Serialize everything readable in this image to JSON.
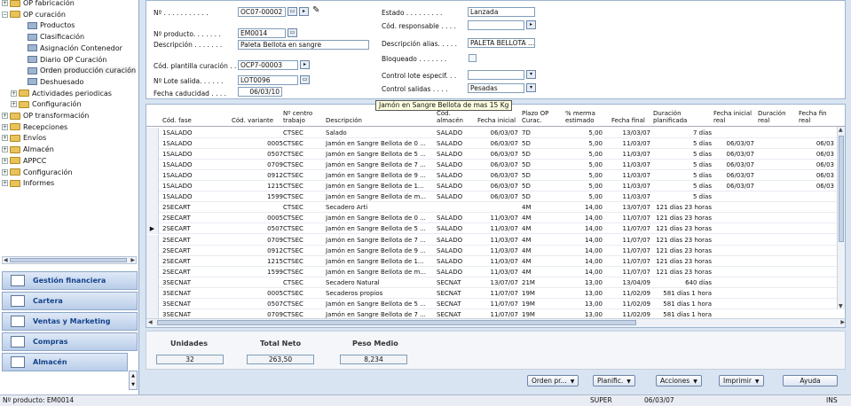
{
  "nav": {
    "tree": [
      {
        "label": "OP fabricación",
        "level": 0,
        "type": "folder",
        "expander": "+"
      },
      {
        "label": "OP curación",
        "level": 0,
        "type": "folder",
        "expander": "−"
      },
      {
        "label": "Productos",
        "level": 2,
        "type": "doc"
      },
      {
        "label": "Clasificación",
        "level": 2,
        "type": "doc"
      },
      {
        "label": "Asignación Contenedor",
        "level": 2,
        "type": "doc"
      },
      {
        "label": "Diario OP Curación",
        "level": 2,
        "type": "doc"
      },
      {
        "label": "Orden producción curación",
        "level": 2,
        "type": "doc"
      },
      {
        "label": "Deshuesado",
        "level": 2,
        "type": "doc"
      },
      {
        "label": "Actividades periodicas",
        "level": 1,
        "type": "folder",
        "expander": "+"
      },
      {
        "label": "Configuración",
        "level": 1,
        "type": "folder",
        "expander": "+"
      },
      {
        "label": "OP transformación",
        "level": 0,
        "type": "folder",
        "expander": "+"
      },
      {
        "label": "Recepciones",
        "level": 0,
        "type": "folder",
        "expander": "+"
      },
      {
        "label": "Envíos",
        "level": 0,
        "type": "folder",
        "expander": "+"
      },
      {
        "label": "Almacén",
        "level": 0,
        "type": "folder",
        "expander": "+"
      },
      {
        "label": "APPCC",
        "level": 0,
        "type": "folder",
        "expander": "+"
      },
      {
        "label": "Configuración",
        "level": 0,
        "type": "folder",
        "expander": "+"
      },
      {
        "label": "Informes",
        "level": 0,
        "type": "folder",
        "expander": "+"
      }
    ],
    "modules": [
      "Gestión financiera",
      "Cartera",
      "Ventas y Marketing",
      "Compras",
      "Almacén"
    ]
  },
  "form": {
    "no_label": "Nº . . . . . . . . . . .",
    "no_value": "OC07-00002",
    "producto_label": "Nº producto. . . . . . .",
    "producto_value": "EM0014",
    "descripcion_label": "Descripción . . . . . . .",
    "descripcion_value": "Paleta Bellota en sangre",
    "plantilla_label": "Cód. plantilla curación . .",
    "plantilla_value": "OCP7-00003",
    "lote_label": "Nº Lote salida. . . . . .",
    "lote_value": "LOT0096",
    "caducidad_label": "Fecha caducidad . . . .",
    "caducidad_value": "06/03/10",
    "estado_label": "Estado . . . . . . . . .",
    "estado_value": "Lanzada",
    "responsable_label": "Cód. responsable . . . .",
    "responsable_value": "",
    "desc_alias_label": "Descripción alias. . . . .",
    "desc_alias_value": "PALETA BELLOTA ...",
    "bloqueado_label": "Bloqueado . . . . . . .",
    "control_lote_label": "Control lote especif. . .",
    "control_lote_value": "",
    "control_salidas_label": "Control salidas . . . .",
    "control_salidas_value": "Pesadas"
  },
  "grid": {
    "headers": {
      "fase": "Cód. fase",
      "variante": "Cód. variante",
      "centro": "Nº centro\ntrabajo",
      "descripcion": "Descripción",
      "almacen": "Cód.\nalmacén",
      "fecha_inicial": "Fecha inicial",
      "plazo": "Plazo OP\nCurac.",
      "merma": "% merma\nestimado",
      "fecha_final": "Fecha final",
      "duracion_plan": "Duración\nplanificada",
      "fecha_inicial_real": "Fecha inicial\nreal",
      "duracion_real": "Duración\nreal",
      "fecha_fin_real": "Fecha fin\nreal"
    },
    "rows": [
      {
        "fase": "1SALADO",
        "variante": "",
        "centro": "CTSEC",
        "descripcion": "Salado",
        "almacen": "SALADO",
        "fecha_inicial": "06/03/07",
        "plazo": "7D",
        "merma": "5,00",
        "fecha_final": "13/03/07",
        "duracion_plan": "7 días",
        "fecha_inicial_real": "",
        "duracion_real": "",
        "fecha_fin_real": "",
        "current": false
      },
      {
        "fase": "1SALADO",
        "variante": "0005",
        "centro": "CTSEC",
        "descripcion": "Jamón en Sangre Bellota de 0 ...",
        "almacen": "SALADO",
        "fecha_inicial": "06/03/07",
        "plazo": "5D",
        "merma": "5,00",
        "fecha_final": "11/03/07",
        "duracion_plan": "5 días",
        "fecha_inicial_real": "06/03/07",
        "duracion_real": "",
        "fecha_fin_real": "06/03",
        "current": false
      },
      {
        "fase": "1SALADO",
        "variante": "0507",
        "centro": "CTSEC",
        "descripcion": "Jamón en Sangre Bellota de 5 ...",
        "almacen": "SALADO",
        "fecha_inicial": "06/03/07",
        "plazo": "5D",
        "merma": "5,00",
        "fecha_final": "11/03/07",
        "duracion_plan": "5 días",
        "fecha_inicial_real": "06/03/07",
        "duracion_real": "",
        "fecha_fin_real": "06/03",
        "current": false
      },
      {
        "fase": "1SALADO",
        "variante": "0709",
        "centro": "CTSEC",
        "descripcion": "Jamón en Sangre Bellota de 7 ...",
        "almacen": "SALADO",
        "fecha_inicial": "06/03/07",
        "plazo": "5D",
        "merma": "5,00",
        "fecha_final": "11/03/07",
        "duracion_plan": "5 días",
        "fecha_inicial_real": "06/03/07",
        "duracion_real": "",
        "fecha_fin_real": "06/03",
        "current": false
      },
      {
        "fase": "1SALADO",
        "variante": "0912",
        "centro": "CTSEC",
        "descripcion": "Jamón en Sangre Bellota de 9 ...",
        "almacen": "SALADO",
        "fecha_inicial": "06/03/07",
        "plazo": "5D",
        "merma": "5,00",
        "fecha_final": "11/03/07",
        "duracion_plan": "5 días",
        "fecha_inicial_real": "06/03/07",
        "duracion_real": "",
        "fecha_fin_real": "06/03",
        "current": false
      },
      {
        "fase": "1SALADO",
        "variante": "1215",
        "centro": "CTSEC",
        "descripcion": "Jamón en Sangre Bellota de 1...",
        "almacen": "SALADO",
        "fecha_inicial": "06/03/07",
        "plazo": "5D",
        "merma": "5,00",
        "fecha_final": "11/03/07",
        "duracion_plan": "5 días",
        "fecha_inicial_real": "06/03/07",
        "duracion_real": "",
        "fecha_fin_real": "06/03",
        "current": false
      },
      {
        "fase": "1SALADO",
        "variante": "1599",
        "centro": "CTSEC",
        "descripcion": "Jamón en Sangre Bellota de m...",
        "almacen": "SALADO",
        "fecha_inicial": "06/03/07",
        "plazo": "5D",
        "merma": "5,00",
        "fecha_final": "11/03/07",
        "duracion_plan": "5 días",
        "fecha_inicial_real": "",
        "duracion_real": "",
        "fecha_fin_real": "",
        "current": false
      },
      {
        "fase": "2SECART",
        "variante": "",
        "centro": "CTSEC",
        "descripcion": "Secadero Arti",
        "almacen": "",
        "fecha_inicial": "",
        "plazo": "4M",
        "merma": "14,00",
        "fecha_final": "13/07/07",
        "duracion_plan": "121 días 23 horas",
        "fecha_inicial_real": "",
        "duracion_real": "",
        "fecha_fin_real": "",
        "current": false
      },
      {
        "fase": "2SECART",
        "variante": "0005",
        "centro": "CTSEC",
        "descripcion": "Jamón en Sangre Bellota de 0 ...",
        "almacen": "SALADO",
        "fecha_inicial": "11/03/07",
        "plazo": "4M",
        "merma": "14,00",
        "fecha_final": "11/07/07",
        "duracion_plan": "121 días 23 horas",
        "fecha_inicial_real": "",
        "duracion_real": "",
        "fecha_fin_real": "",
        "current": false
      },
      {
        "fase": "2SECART",
        "variante": "0507",
        "centro": "CTSEC",
        "descripcion": "Jamón en Sangre Bellota de 5 ...",
        "almacen": "SALADO",
        "fecha_inicial": "11/03/07",
        "plazo": "4M",
        "merma": "14,00",
        "fecha_final": "11/07/07",
        "duracion_plan": "121 días 23 horas",
        "fecha_inicial_real": "",
        "duracion_real": "",
        "fecha_fin_real": "",
        "current": true
      },
      {
        "fase": "2SECART",
        "variante": "0709",
        "centro": "CTSEC",
        "descripcion": "Jamón en Sangre Bellota de 7 ...",
        "almacen": "SALADO",
        "fecha_inicial": "11/03/07",
        "plazo": "4M",
        "merma": "14,00",
        "fecha_final": "11/07/07",
        "duracion_plan": "121 días 23 horas",
        "fecha_inicial_real": "",
        "duracion_real": "",
        "fecha_fin_real": "",
        "current": false
      },
      {
        "fase": "2SECART",
        "variante": "0912",
        "centro": "CTSEC",
        "descripcion": "Jamón en Sangre Bellota de 9 ...",
        "almacen": "SALADO",
        "fecha_inicial": "11/03/07",
        "plazo": "4M",
        "merma": "14,00",
        "fecha_final": "11/07/07",
        "duracion_plan": "121 días 23 horas",
        "fecha_inicial_real": "",
        "duracion_real": "",
        "fecha_fin_real": "",
        "current": false
      },
      {
        "fase": "2SECART",
        "variante": "1215",
        "centro": "CTSEC",
        "descripcion": "Jamón en Sangre Bellota de 1...",
        "almacen": "SALADO",
        "fecha_inicial": "11/03/07",
        "plazo": "4M",
        "merma": "14,00",
        "fecha_final": "11/07/07",
        "duracion_plan": "121 días 23 horas",
        "fecha_inicial_real": "",
        "duracion_real": "",
        "fecha_fin_real": "",
        "current": false
      },
      {
        "fase": "2SECART",
        "variante": "1599",
        "centro": "CTSEC",
        "descripcion": "Jamón en Sangre Bellota de m...",
        "almacen": "SALADO",
        "fecha_inicial": "11/03/07",
        "plazo": "4M",
        "merma": "14,00",
        "fecha_final": "11/07/07",
        "duracion_plan": "121 días 23 horas",
        "fecha_inicial_real": "",
        "duracion_real": "",
        "fecha_fin_real": "",
        "current": false
      },
      {
        "fase": "3SECNAT",
        "variante": "",
        "centro": "CTSEC",
        "descripcion": "Secadero Natural",
        "almacen": "SECNAT",
        "fecha_inicial": "13/07/07",
        "plazo": "21M",
        "merma": "13,00",
        "fecha_final": "13/04/09",
        "duracion_plan": "640 días",
        "fecha_inicial_real": "",
        "duracion_real": "",
        "fecha_fin_real": "",
        "current": false
      },
      {
        "fase": "3SECNAT",
        "variante": "0005",
        "centro": "CTSEC",
        "descripcion": "Secaderos propios",
        "almacen": "SECNAT",
        "fecha_inicial": "11/07/07",
        "plazo": "19M",
        "merma": "13,00",
        "fecha_final": "11/02/09",
        "duracion_plan": "581 días 1 hora",
        "fecha_inicial_real": "",
        "duracion_real": "",
        "fecha_fin_real": "",
        "current": false
      },
      {
        "fase": "3SECNAT",
        "variante": "0507",
        "centro": "CTSEC",
        "descripcion": "Jamón en Sangre Bellota de 5 ...",
        "almacen": "SECNAT",
        "fecha_inicial": "11/07/07",
        "plazo": "19M",
        "merma": "13,00",
        "fecha_final": "11/02/09",
        "duracion_plan": "581 días 1 hora",
        "fecha_inicial_real": "",
        "duracion_real": "",
        "fecha_fin_real": "",
        "current": false
      },
      {
        "fase": "3SECNAT",
        "variante": "0709",
        "centro": "CTSEC",
        "descripcion": "Jamón en Sangre Bellota de 7 ...",
        "almacen": "SECNAT",
        "fecha_inicial": "11/07/07",
        "plazo": "19M",
        "merma": "13,00",
        "fecha_final": "11/02/09",
        "duracion_plan": "581 días 1 hora",
        "fecha_inicial_real": "",
        "duracion_real": "",
        "fecha_fin_real": "",
        "current": false
      }
    ],
    "tooltip": "Jamón en Sangre Bellota de mas 15 Kg"
  },
  "summary": {
    "unidades_label": "Unidades",
    "unidades_value": "32",
    "total_neto_label": "Total Neto",
    "total_neto_value": "263,50",
    "peso_medio_label": "Peso Medio",
    "peso_medio_value": "8,234"
  },
  "actions": {
    "orden": "Orden pr...",
    "planific": "Planific.",
    "acciones": "Acciones",
    "imprimir": "Imprimir",
    "ayuda": "Ayuda"
  },
  "status": {
    "producto": "Nº producto: EM0014",
    "user": "SUPER",
    "date": "06/03/07",
    "mode": "INS"
  }
}
